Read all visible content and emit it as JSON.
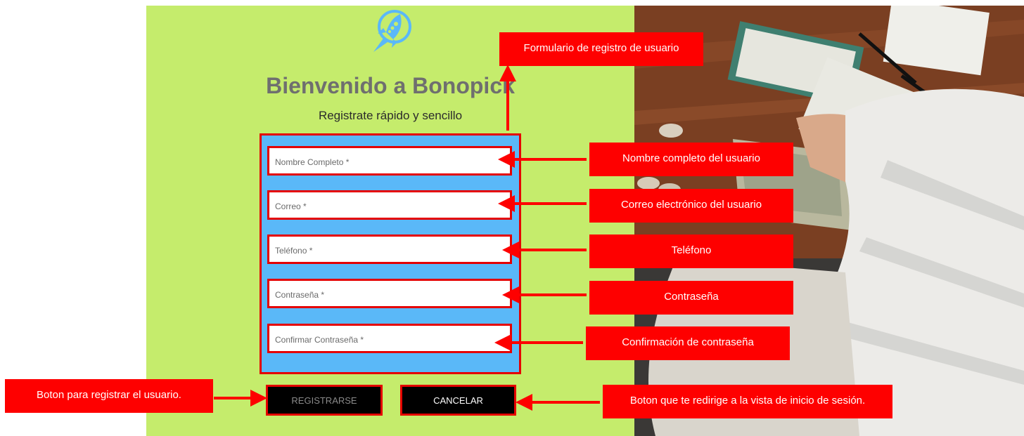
{
  "header": {
    "title": "Bienvenido a Bonopick",
    "subtitle": "Registrate rápido y sencillo",
    "logo_icon": "rocket-icon"
  },
  "form": {
    "fields": [
      {
        "placeholder": "Nombre Completo *"
      },
      {
        "placeholder": "Correo *"
      },
      {
        "placeholder": "Teléfono *"
      },
      {
        "placeholder": "Contraseña *"
      },
      {
        "placeholder": "Confirmar Contraseña *"
      }
    ],
    "register_label": "REGISTRARSE",
    "cancel_label": "CANCELAR"
  },
  "annotations": {
    "form": "Formulario de registro de usuario",
    "name": "Nombre completo del usuario",
    "email": "Correo electrónico del usuario",
    "phone": "Teléfono",
    "password": "Contraseña",
    "confirm": "Confirmación de contraseña",
    "register_button": "Boton para registrar el usuario.",
    "cancel_button": "Boton que te redirige a la vista de inicio de sesión."
  },
  "colors": {
    "panel_bg": "#c5ec6c",
    "form_bg": "#5ab8f8",
    "annotation_red": "#fe0000",
    "title_gray": "#6f6f6f"
  }
}
